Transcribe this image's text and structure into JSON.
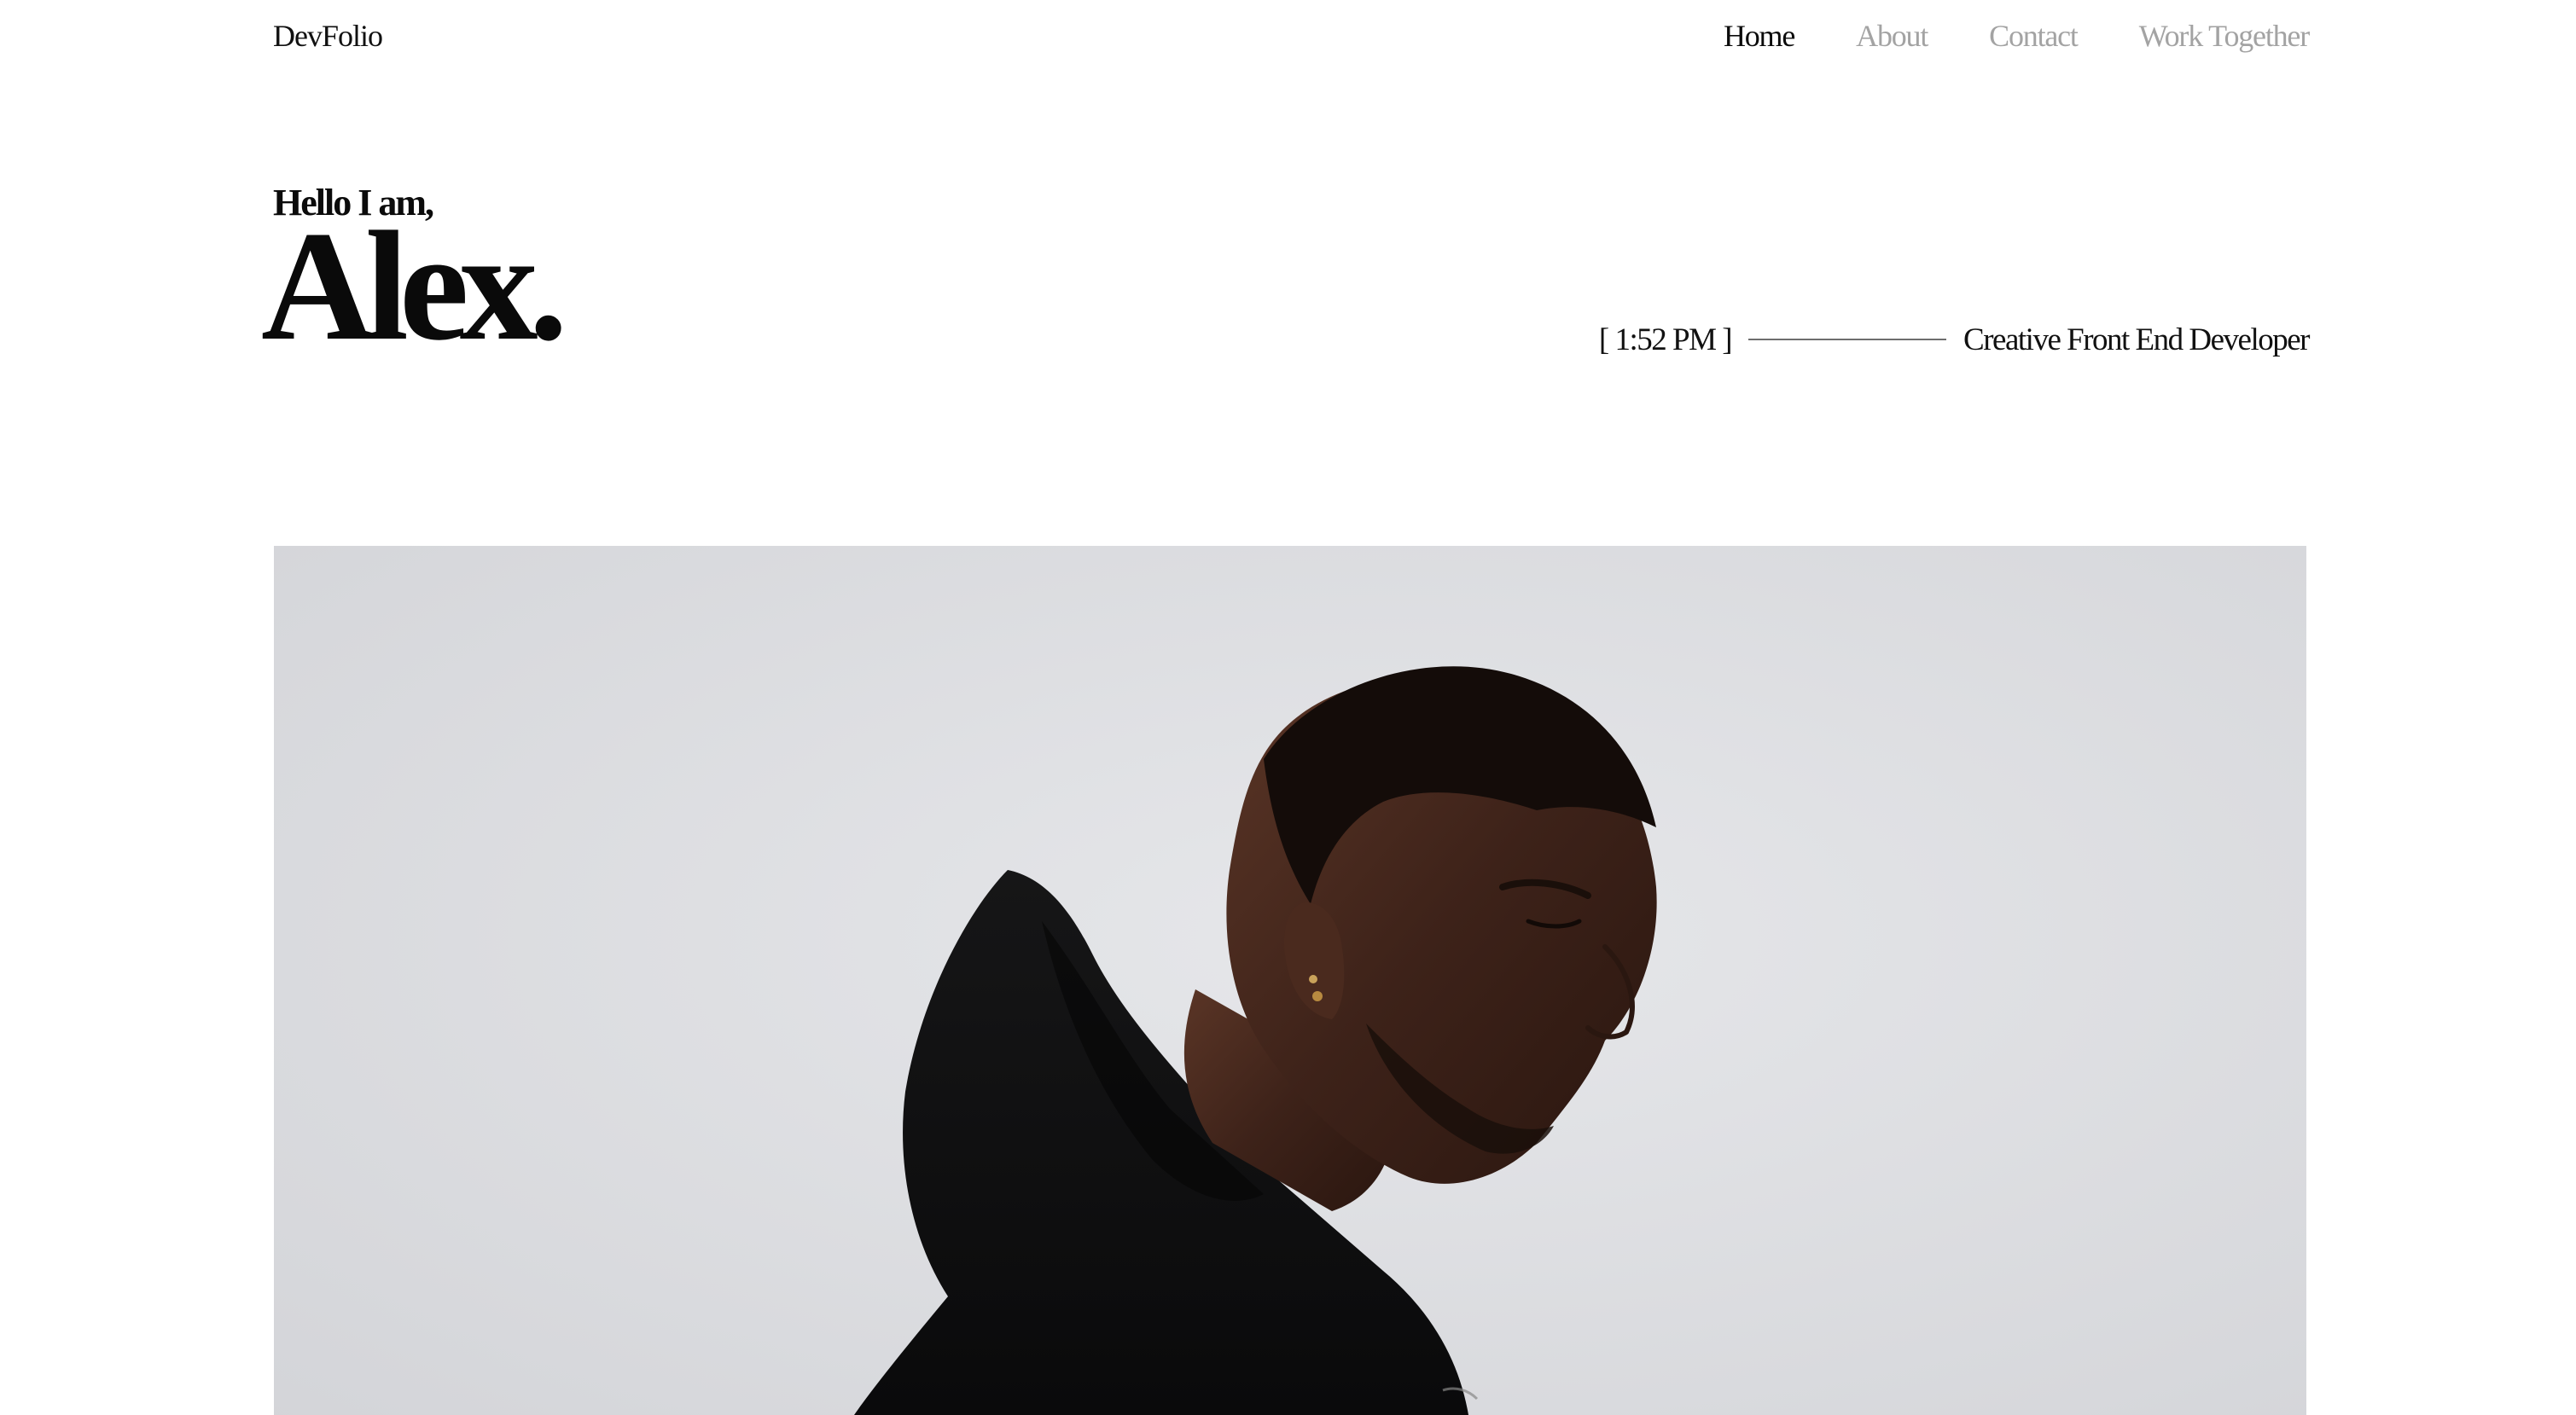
{
  "header": {
    "logo": "DevFolio",
    "nav": [
      {
        "label": "Home",
        "active": true
      },
      {
        "label": "About",
        "active": false
      },
      {
        "label": "Contact",
        "active": false
      },
      {
        "label": "Work Together",
        "active": false
      }
    ]
  },
  "hero": {
    "greeting": "Hello I am,",
    "name": "Alex.",
    "time": "[ 1:52 PM ]",
    "role": "Creative Front End Developer"
  },
  "image": {
    "subject": "portrait-photo"
  },
  "colors": {
    "text": "#0a0a0a",
    "muted_nav": "#a3a3a3",
    "background": "#ffffff",
    "photo_backdrop": "#dcdde1"
  }
}
